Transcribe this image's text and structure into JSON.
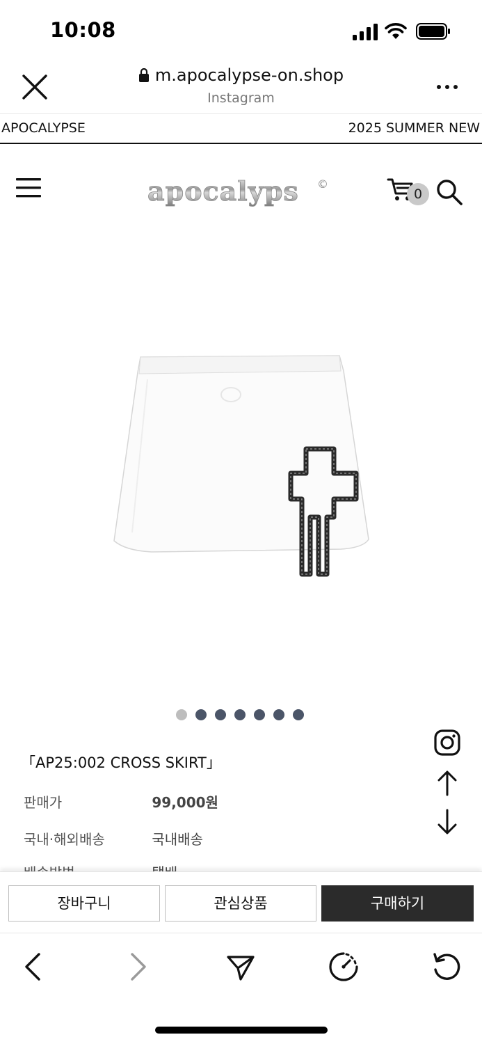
{
  "status_bar": {
    "time": "10:08",
    "icons": [
      "cellular-signal-icon",
      "wifi-icon",
      "battery-icon"
    ]
  },
  "browser": {
    "url": "m.apocalypse-on.shop",
    "source_app": "Instagram",
    "close_icon": "close-icon",
    "more_icon": "more-icon"
  },
  "marquee": {
    "left_text": "APOCALYPSE",
    "right_text": "2025 SUMMER NEW"
  },
  "site_header": {
    "logo_text": "apocalyps",
    "logo_mark": "©",
    "cart_count": "0"
  },
  "carousel": {
    "total": 7,
    "active_index": 0
  },
  "product": {
    "title": "「AP25:002 CROSS SKIRT」",
    "price_label": "판매가",
    "price_value": "99,000원",
    "shipping_label": "국내·해외배송",
    "shipping_value": "국내배송",
    "method_label": "배송방법",
    "method_value": "택배"
  },
  "actions": {
    "cart_label": "장바구니",
    "wishlist_label": "관심상품",
    "buy_label": "구매하기"
  },
  "colors": {
    "buy_button_bg": "#2b2b2b",
    "dot_active": "#bdbdbd",
    "dot_inactive": "#4b5568"
  }
}
